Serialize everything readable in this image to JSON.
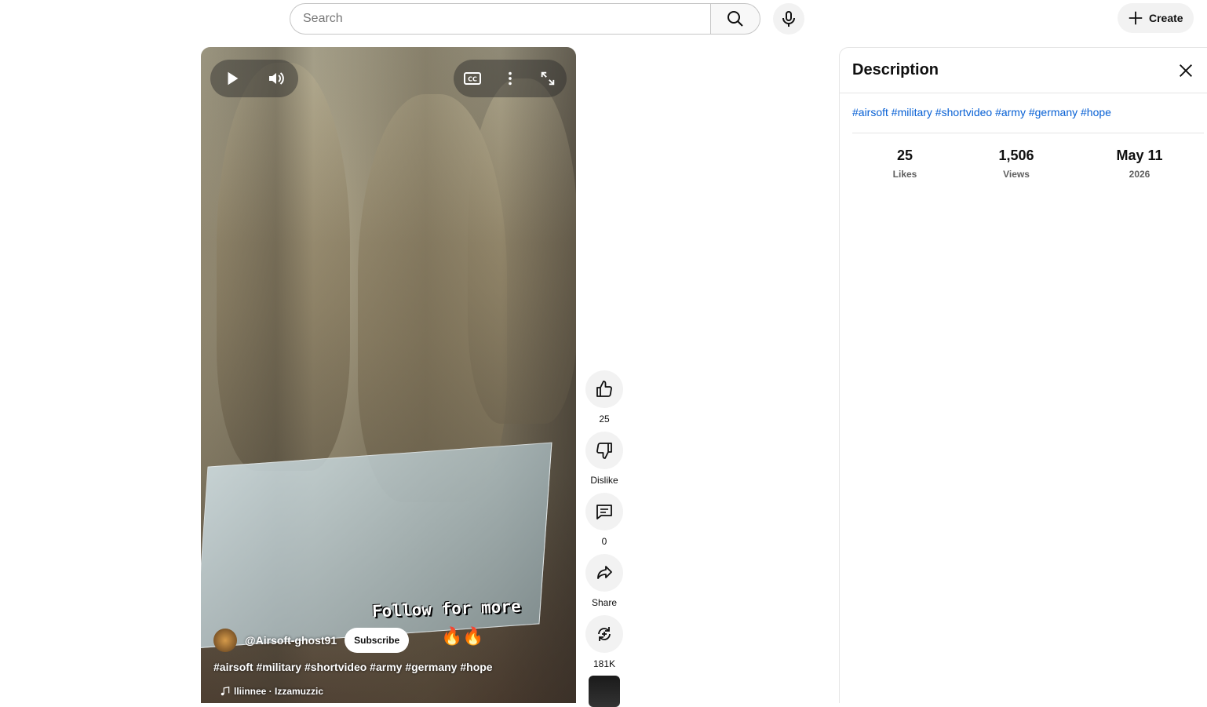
{
  "search": {
    "placeholder": "Search"
  },
  "header": {
    "create_label": "Create"
  },
  "player": {
    "overlay_text": "Follow for more",
    "overlay_emoji": "🔥🔥",
    "channel_name": "@Airsoft-ghost91",
    "subscribe_label": "Subscribe",
    "title": "#airsoft #military #shortvideo #army #germany #hope",
    "music": "lliinnee · Izzamuzzic"
  },
  "actions": {
    "like_count": "25",
    "dislike_label": "Dislike",
    "comment_count": "0",
    "share_label": "Share",
    "remix_count": "181K"
  },
  "description": {
    "title": "Description",
    "hashtags": "#airsoft #military #shortvideo #army #germany #hope",
    "stats": [
      {
        "value": "25",
        "label": "Likes"
      },
      {
        "value": "1,506",
        "label": "Views"
      },
      {
        "value": "May 11",
        "label": "2026"
      }
    ]
  }
}
